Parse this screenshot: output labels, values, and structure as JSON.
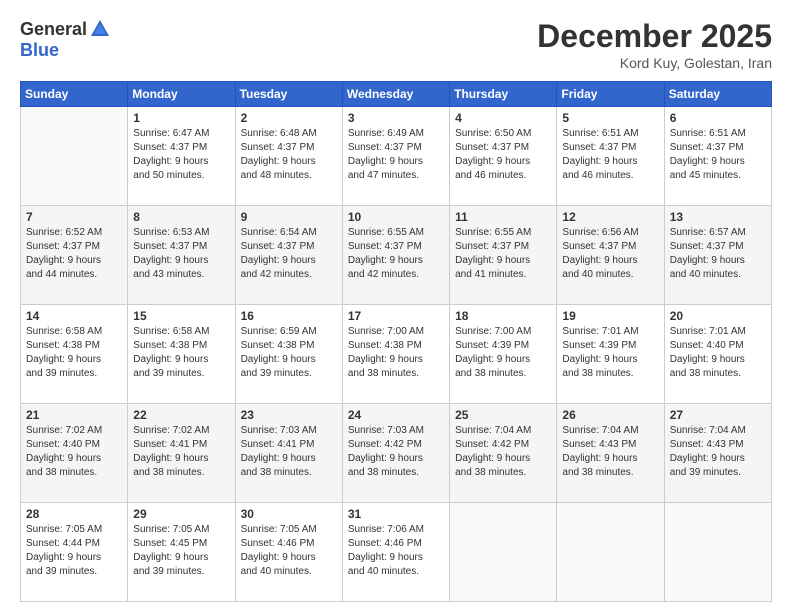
{
  "header": {
    "logo_general": "General",
    "logo_blue": "Blue",
    "month_title": "December 2025",
    "location": "Kord Kuy, Golestan, Iran"
  },
  "weekdays": [
    "Sunday",
    "Monday",
    "Tuesday",
    "Wednesday",
    "Thursday",
    "Friday",
    "Saturday"
  ],
  "weeks": [
    [
      {
        "day": "",
        "info": ""
      },
      {
        "day": "1",
        "info": "Sunrise: 6:47 AM\nSunset: 4:37 PM\nDaylight: 9 hours\nand 50 minutes."
      },
      {
        "day": "2",
        "info": "Sunrise: 6:48 AM\nSunset: 4:37 PM\nDaylight: 9 hours\nand 48 minutes."
      },
      {
        "day": "3",
        "info": "Sunrise: 6:49 AM\nSunset: 4:37 PM\nDaylight: 9 hours\nand 47 minutes."
      },
      {
        "day": "4",
        "info": "Sunrise: 6:50 AM\nSunset: 4:37 PM\nDaylight: 9 hours\nand 46 minutes."
      },
      {
        "day": "5",
        "info": "Sunrise: 6:51 AM\nSunset: 4:37 PM\nDaylight: 9 hours\nand 46 minutes."
      },
      {
        "day": "6",
        "info": "Sunrise: 6:51 AM\nSunset: 4:37 PM\nDaylight: 9 hours\nand 45 minutes."
      }
    ],
    [
      {
        "day": "7",
        "info": "Sunrise: 6:52 AM\nSunset: 4:37 PM\nDaylight: 9 hours\nand 44 minutes."
      },
      {
        "day": "8",
        "info": "Sunrise: 6:53 AM\nSunset: 4:37 PM\nDaylight: 9 hours\nand 43 minutes."
      },
      {
        "day": "9",
        "info": "Sunrise: 6:54 AM\nSunset: 4:37 PM\nDaylight: 9 hours\nand 42 minutes."
      },
      {
        "day": "10",
        "info": "Sunrise: 6:55 AM\nSunset: 4:37 PM\nDaylight: 9 hours\nand 42 minutes."
      },
      {
        "day": "11",
        "info": "Sunrise: 6:55 AM\nSunset: 4:37 PM\nDaylight: 9 hours\nand 41 minutes."
      },
      {
        "day": "12",
        "info": "Sunrise: 6:56 AM\nSunset: 4:37 PM\nDaylight: 9 hours\nand 40 minutes."
      },
      {
        "day": "13",
        "info": "Sunrise: 6:57 AM\nSunset: 4:37 PM\nDaylight: 9 hours\nand 40 minutes."
      }
    ],
    [
      {
        "day": "14",
        "info": "Sunrise: 6:58 AM\nSunset: 4:38 PM\nDaylight: 9 hours\nand 39 minutes."
      },
      {
        "day": "15",
        "info": "Sunrise: 6:58 AM\nSunset: 4:38 PM\nDaylight: 9 hours\nand 39 minutes."
      },
      {
        "day": "16",
        "info": "Sunrise: 6:59 AM\nSunset: 4:38 PM\nDaylight: 9 hours\nand 39 minutes."
      },
      {
        "day": "17",
        "info": "Sunrise: 7:00 AM\nSunset: 4:38 PM\nDaylight: 9 hours\nand 38 minutes."
      },
      {
        "day": "18",
        "info": "Sunrise: 7:00 AM\nSunset: 4:39 PM\nDaylight: 9 hours\nand 38 minutes."
      },
      {
        "day": "19",
        "info": "Sunrise: 7:01 AM\nSunset: 4:39 PM\nDaylight: 9 hours\nand 38 minutes."
      },
      {
        "day": "20",
        "info": "Sunrise: 7:01 AM\nSunset: 4:40 PM\nDaylight: 9 hours\nand 38 minutes."
      }
    ],
    [
      {
        "day": "21",
        "info": "Sunrise: 7:02 AM\nSunset: 4:40 PM\nDaylight: 9 hours\nand 38 minutes."
      },
      {
        "day": "22",
        "info": "Sunrise: 7:02 AM\nSunset: 4:41 PM\nDaylight: 9 hours\nand 38 minutes."
      },
      {
        "day": "23",
        "info": "Sunrise: 7:03 AM\nSunset: 4:41 PM\nDaylight: 9 hours\nand 38 minutes."
      },
      {
        "day": "24",
        "info": "Sunrise: 7:03 AM\nSunset: 4:42 PM\nDaylight: 9 hours\nand 38 minutes."
      },
      {
        "day": "25",
        "info": "Sunrise: 7:04 AM\nSunset: 4:42 PM\nDaylight: 9 hours\nand 38 minutes."
      },
      {
        "day": "26",
        "info": "Sunrise: 7:04 AM\nSunset: 4:43 PM\nDaylight: 9 hours\nand 38 minutes."
      },
      {
        "day": "27",
        "info": "Sunrise: 7:04 AM\nSunset: 4:43 PM\nDaylight: 9 hours\nand 39 minutes."
      }
    ],
    [
      {
        "day": "28",
        "info": "Sunrise: 7:05 AM\nSunset: 4:44 PM\nDaylight: 9 hours\nand 39 minutes."
      },
      {
        "day": "29",
        "info": "Sunrise: 7:05 AM\nSunset: 4:45 PM\nDaylight: 9 hours\nand 39 minutes."
      },
      {
        "day": "30",
        "info": "Sunrise: 7:05 AM\nSunset: 4:46 PM\nDaylight: 9 hours\nand 40 minutes."
      },
      {
        "day": "31",
        "info": "Sunrise: 7:06 AM\nSunset: 4:46 PM\nDaylight: 9 hours\nand 40 minutes."
      },
      {
        "day": "",
        "info": ""
      },
      {
        "day": "",
        "info": ""
      },
      {
        "day": "",
        "info": ""
      }
    ]
  ]
}
